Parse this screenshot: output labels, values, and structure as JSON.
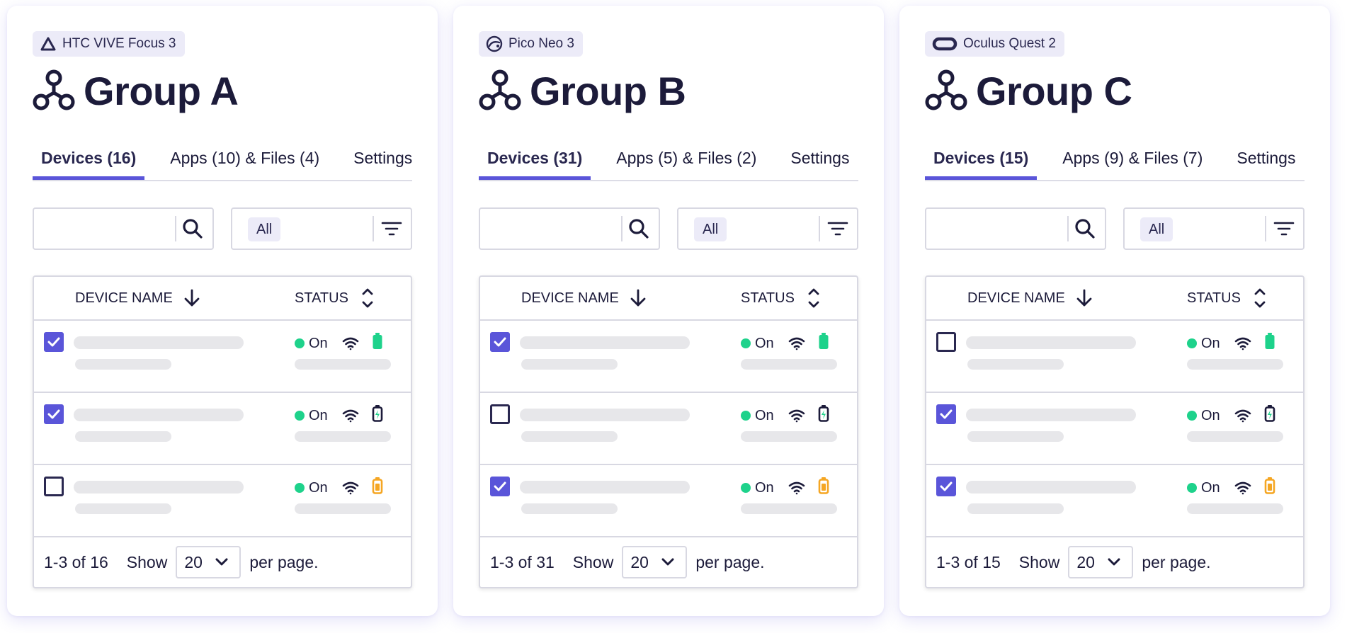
{
  "colors": {
    "accent": "#5a55d9",
    "text": "#1c1b3a",
    "status_on": "#1ed28b",
    "battery_full": "#1ed28b",
    "battery_low": "#f5a623",
    "battery_charging": "#1c1b3a",
    "skeleton": "#e7e7ea"
  },
  "groups": [
    {
      "device": {
        "icon": "htc-vive-icon",
        "label": "HTC VIVE Focus 3"
      },
      "title": "Group A",
      "tabs": [
        {
          "label": "Devices (16)",
          "active": true
        },
        {
          "label": "Apps (10) & Files (4)",
          "active": false
        },
        {
          "label": "Settings",
          "active": false
        }
      ],
      "search": {
        "placeholder": ""
      },
      "filter": {
        "selected": "All"
      },
      "table": {
        "col_name": "DEVICE NAME",
        "col_status": "STATUS",
        "rows": [
          {
            "checked": true,
            "status": "On",
            "battery": "full"
          },
          {
            "checked": true,
            "status": "On",
            "battery": "charging"
          },
          {
            "checked": false,
            "status": "On",
            "battery": "low"
          }
        ]
      },
      "footer": {
        "range": "1-3 of 16",
        "show": "Show",
        "per_page": "20",
        "per_page_suffix": "per page."
      }
    },
    {
      "device": {
        "icon": "pico-neo-icon",
        "label": "Pico Neo 3"
      },
      "title": "Group B",
      "tabs": [
        {
          "label": "Devices (31)",
          "active": true
        },
        {
          "label": "Apps (5) & Files (2)",
          "active": false
        },
        {
          "label": "Settings",
          "active": false
        }
      ],
      "search": {
        "placeholder": ""
      },
      "filter": {
        "selected": "All"
      },
      "table": {
        "col_name": "DEVICE NAME",
        "col_status": "STATUS",
        "rows": [
          {
            "checked": true,
            "status": "On",
            "battery": "full"
          },
          {
            "checked": false,
            "status": "On",
            "battery": "charging"
          },
          {
            "checked": true,
            "status": "On",
            "battery": "low"
          }
        ]
      },
      "footer": {
        "range": "1-3 of 31",
        "show": "Show",
        "per_page": "20",
        "per_page_suffix": "per page."
      }
    },
    {
      "device": {
        "icon": "oculus-quest-icon",
        "label": "Oculus Quest 2"
      },
      "title": "Group C",
      "tabs": [
        {
          "label": "Devices (15)",
          "active": true
        },
        {
          "label": "Apps (9) & Files (7)",
          "active": false
        },
        {
          "label": "Settings",
          "active": false
        }
      ],
      "search": {
        "placeholder": ""
      },
      "filter": {
        "selected": "All"
      },
      "table": {
        "col_name": "DEVICE NAME",
        "col_status": "STATUS",
        "rows": [
          {
            "checked": false,
            "status": "On",
            "battery": "full"
          },
          {
            "checked": true,
            "status": "On",
            "battery": "charging"
          },
          {
            "checked": true,
            "status": "On",
            "battery": "low"
          }
        ]
      },
      "footer": {
        "range": "1-3 of 15",
        "show": "Show",
        "per_page": "20",
        "per_page_suffix": "per page."
      }
    }
  ]
}
